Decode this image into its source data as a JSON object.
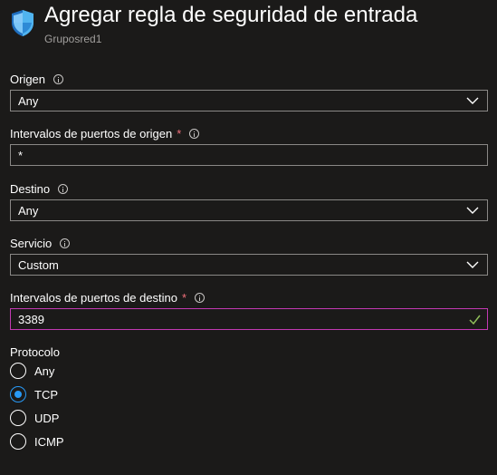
{
  "header": {
    "title": "Agregar regla de seguridad de entrada",
    "subtitle": "Gruposred1",
    "icon": "shield-icon"
  },
  "fields": {
    "origen": {
      "label": "Origen",
      "value": "Any"
    },
    "source_ports": {
      "label": "Intervalos de puertos de origen",
      "required": "*",
      "value": "*"
    },
    "destino": {
      "label": "Destino",
      "value": "Any"
    },
    "servicio": {
      "label": "Servicio",
      "value": "Custom"
    },
    "dest_ports": {
      "label": "Intervalos de puertos de destino",
      "required": "*",
      "value": "3389"
    }
  },
  "protocol": {
    "label": "Protocolo",
    "options": [
      "Any",
      "TCP",
      "UDP",
      "ICMP"
    ],
    "selected": "TCP"
  },
  "colors": {
    "background": "#1b1a19",
    "accent": "#2899f5",
    "focus_border": "#c239b3",
    "required": "#f1707b",
    "valid_check": "#8fbe5a"
  }
}
